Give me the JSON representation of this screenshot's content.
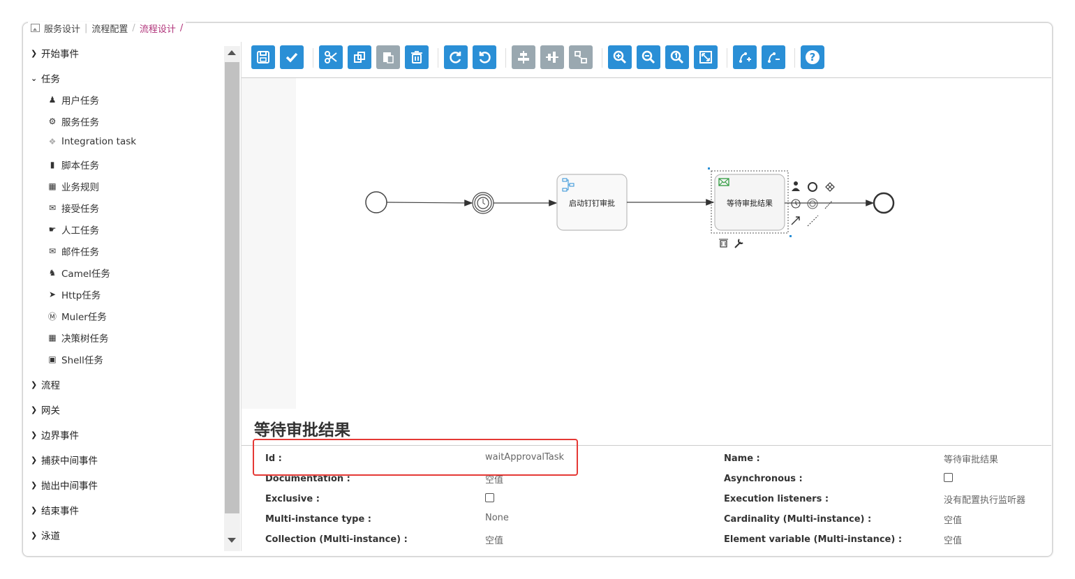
{
  "breadcrumb": {
    "items": [
      "服务设计",
      "流程配置",
      "流程设计"
    ],
    "trailing": "/"
  },
  "palette": {
    "groups": [
      {
        "label": "开始事件",
        "expanded": false
      },
      {
        "label": "任务",
        "expanded": true
      },
      {
        "label": "流程",
        "expanded": false
      },
      {
        "label": "网关",
        "expanded": false
      },
      {
        "label": "边界事件",
        "expanded": false
      },
      {
        "label": "捕获中间事件",
        "expanded": false
      },
      {
        "label": "抛出中间事件",
        "expanded": false
      },
      {
        "label": "结束事件",
        "expanded": false
      },
      {
        "label": "泳道",
        "expanded": false
      }
    ],
    "task_items": [
      {
        "label": "用户任务",
        "icon": "user-icon"
      },
      {
        "label": "服务任务",
        "icon": "gear-icon"
      },
      {
        "label": "Integration task",
        "icon": "integration-icon"
      },
      {
        "label": "脚本任务",
        "icon": "script-icon"
      },
      {
        "label": "业务规则",
        "icon": "table-icon"
      },
      {
        "label": "接受任务",
        "icon": "envelope-icon"
      },
      {
        "label": "人工任务",
        "icon": "hand-icon"
      },
      {
        "label": "邮件任务",
        "icon": "mail-icon"
      },
      {
        "label": "Camel任务",
        "icon": "camel-icon"
      },
      {
        "label": "Http任务",
        "icon": "rocket-icon"
      },
      {
        "label": "Muler任务",
        "icon": "mule-icon"
      },
      {
        "label": "决策树任务",
        "icon": "grid-icon"
      },
      {
        "label": "Shell任务",
        "icon": "terminal-icon"
      }
    ]
  },
  "toolbar": {
    "buttons": [
      {
        "name": "save",
        "icon": "save-icon"
      },
      {
        "name": "validate",
        "icon": "check-icon"
      },
      {
        "name": "cut",
        "icon": "scissors-icon"
      },
      {
        "name": "copy",
        "icon": "copy-icon"
      },
      {
        "name": "paste",
        "icon": "paste-icon"
      },
      {
        "name": "delete",
        "icon": "trash-icon"
      },
      {
        "name": "redo",
        "icon": "redo-icon"
      },
      {
        "name": "undo",
        "icon": "undo-icon"
      },
      {
        "name": "align-vertical",
        "icon": "align-vertical-icon"
      },
      {
        "name": "align-horizontal",
        "icon": "align-horizontal-icon"
      },
      {
        "name": "same-size",
        "icon": "same-size-icon"
      },
      {
        "name": "zoom-in",
        "icon": "zoom-in-icon"
      },
      {
        "name": "zoom-out",
        "icon": "zoom-out-icon"
      },
      {
        "name": "zoom-actual",
        "icon": "zoom-actual-icon"
      },
      {
        "name": "zoom-fit",
        "icon": "zoom-fit-icon"
      },
      {
        "name": "add-bendpoint",
        "icon": "add-bendpoint-icon"
      },
      {
        "name": "remove-bendpoint",
        "icon": "remove-bendpoint-icon"
      },
      {
        "name": "help",
        "icon": "help-icon"
      }
    ],
    "colors": {
      "active": "#2a8fd6",
      "disabled": "#9aa8b0"
    }
  },
  "diagram": {
    "tasks": [
      {
        "label": "启动钉钉审批",
        "icon": "service-task-icon"
      },
      {
        "label": "等待审批结果",
        "icon": "receive-task-icon"
      }
    ]
  },
  "properties": {
    "title": "等待审批结果",
    "left": [
      {
        "label": "Id :",
        "value": "waitApprovalTask",
        "type": "text"
      },
      {
        "label": "Documentation :",
        "value": "空值",
        "type": "text"
      },
      {
        "label": "Exclusive :",
        "value": "",
        "type": "checkbox"
      },
      {
        "label": "Multi-instance type :",
        "value": "None",
        "type": "text"
      },
      {
        "label": "Collection (Multi-instance) :",
        "value": "空值",
        "type": "text"
      }
    ],
    "right": [
      {
        "label": "Name :",
        "value": "等待审批结果",
        "type": "text"
      },
      {
        "label": "Asynchronous :",
        "value": "",
        "type": "checkbox"
      },
      {
        "label": "Execution listeners :",
        "value": "没有配置执行监听器",
        "type": "text"
      },
      {
        "label": "Cardinality (Multi-instance) :",
        "value": "空值",
        "type": "text"
      },
      {
        "label": "Element variable (Multi-instance) :",
        "value": "空值",
        "type": "text"
      }
    ],
    "highlight_color": "#e53935"
  }
}
